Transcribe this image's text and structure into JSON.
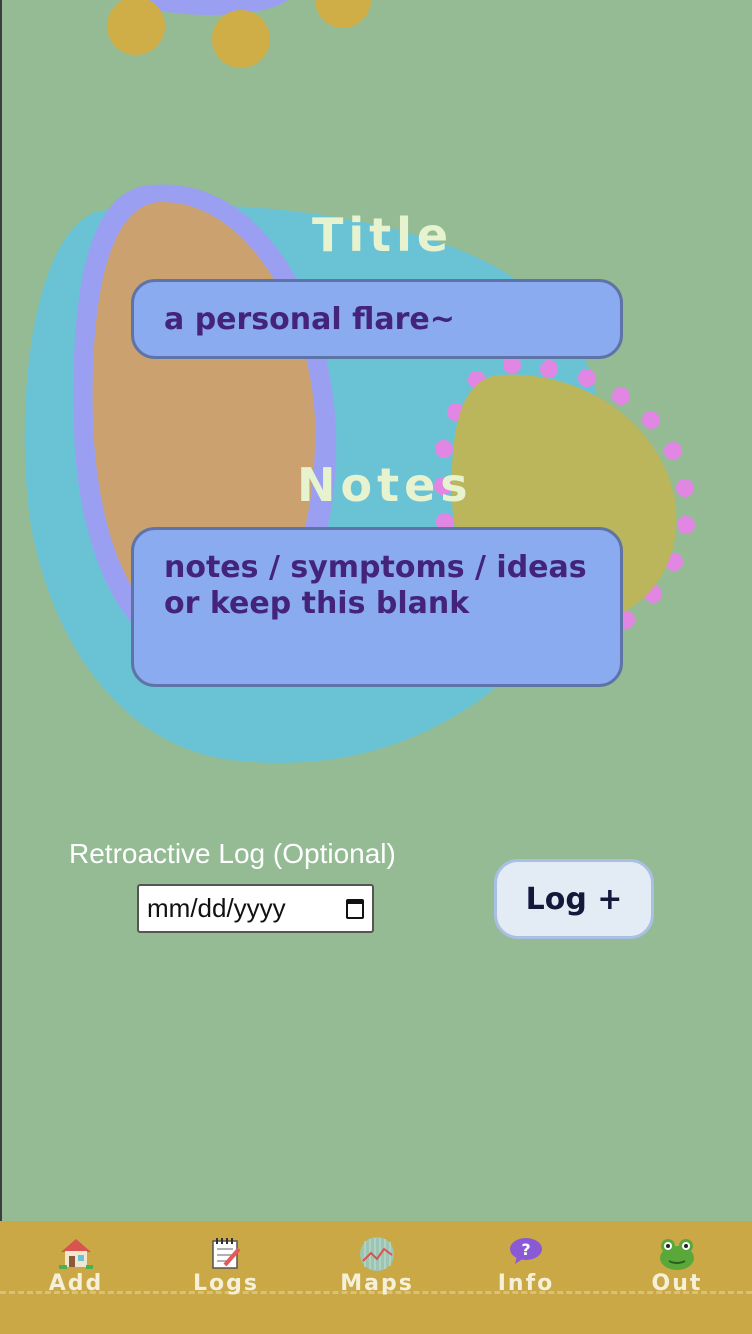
{
  "form": {
    "title_label": "Title",
    "title_placeholder": "a personal flare~",
    "notes_label": "Notes",
    "notes_placeholder": "notes / symptoms / ideas or keep this blank",
    "retro_label": "Retroactive Log (Optional)",
    "date_placeholder": "mm/dd/yyyy",
    "log_button_label": "Log +"
  },
  "tabs": [
    {
      "label": "Add",
      "icon": "house-icon"
    },
    {
      "label": "Logs",
      "icon": "notepad-icon"
    },
    {
      "label": "Maps",
      "icon": "map-chart-icon"
    },
    {
      "label": "Info",
      "icon": "question-bubble-icon"
    },
    {
      "label": "Out",
      "icon": "frog-icon"
    }
  ],
  "colors": {
    "background": "#94bb94",
    "input_fill": "#8aabef",
    "input_text": "#44237a",
    "label_text": "#e7f2cf",
    "tab_bar": "#c9a845",
    "button_fill": "#e3ebf5"
  }
}
